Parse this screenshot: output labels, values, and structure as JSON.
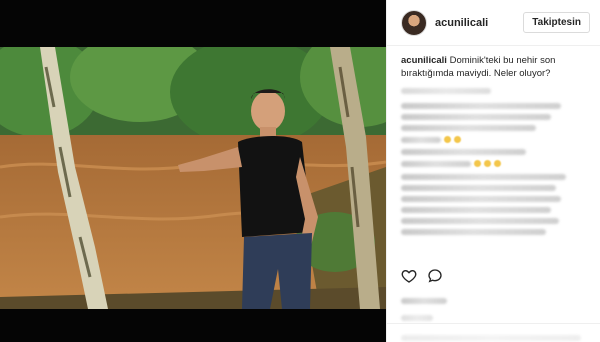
{
  "post": {
    "username": "acunilicali",
    "follow_label": "Takiptesin",
    "caption_text": "Dominik'teki bu nehir son bıraktığımda maviydi. Neler oluyor?"
  },
  "icons": {
    "like": "heart-outline-icon",
    "comment": "speech-bubble-outline-icon"
  },
  "colors": {
    "text": "#262626",
    "muted": "#b3b3b3",
    "border": "#efefef",
    "media_bg": "#050505"
  }
}
